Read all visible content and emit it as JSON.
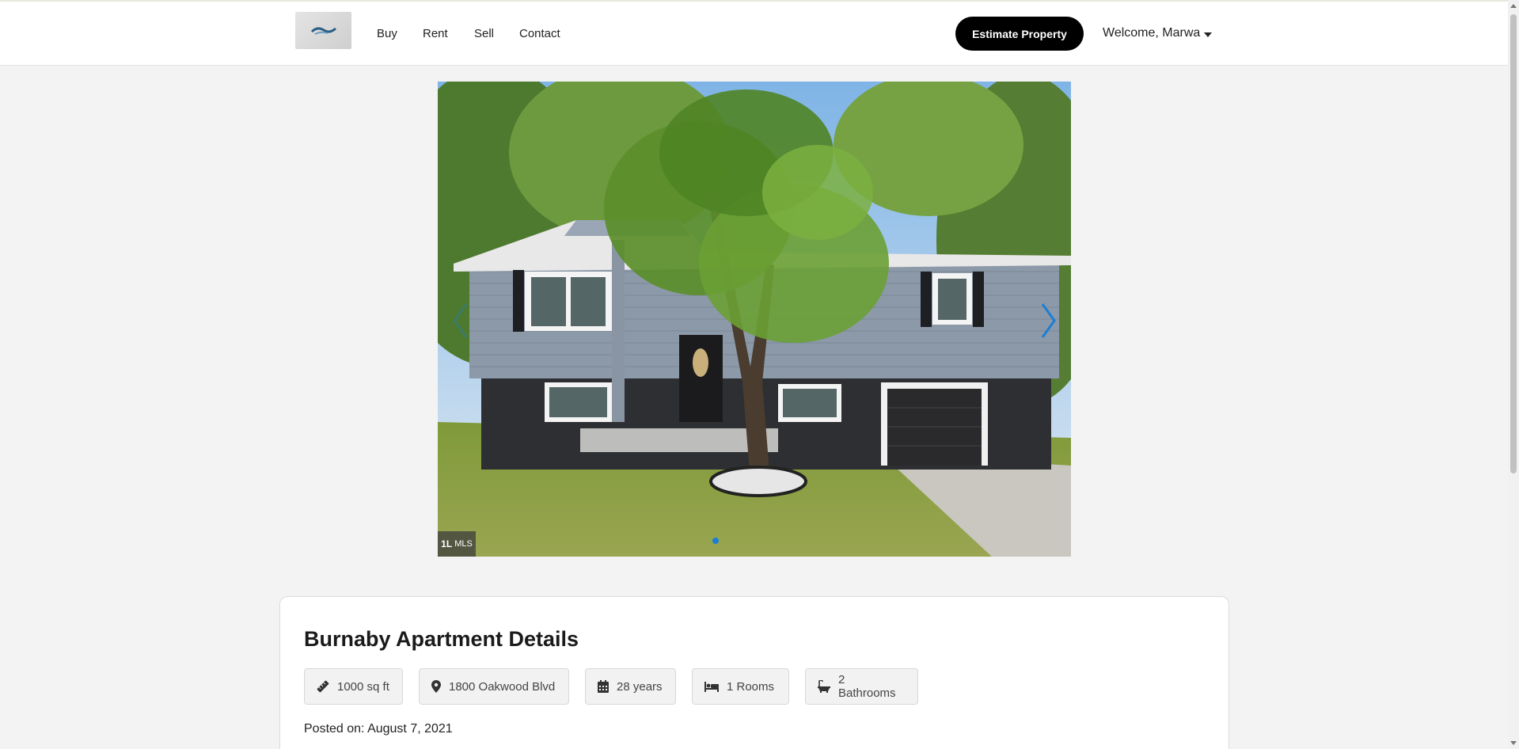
{
  "header": {
    "nav": [
      {
        "label": "Buy"
      },
      {
        "label": "Rent"
      },
      {
        "label": "Sell"
      },
      {
        "label": "Contact"
      }
    ],
    "estimate_button": "Estimate Property",
    "welcome": "Welcome, Marwa"
  },
  "carousel": {
    "watermark": "MLS",
    "total_slides": 1,
    "active_slide": 1,
    "accent_color": "#1a7fd4"
  },
  "details": {
    "title": "Burnaby Apartment Details",
    "features": [
      {
        "icon": "ruler-icon",
        "label": "1000 sq ft"
      },
      {
        "icon": "map-pin-icon",
        "label": "1800 Oakwood Blvd"
      },
      {
        "icon": "calendar-icon",
        "label": "28 years"
      },
      {
        "icon": "bed-icon",
        "label": "1 Rooms"
      },
      {
        "icon": "bath-icon",
        "label": "2 Bathrooms"
      }
    ],
    "posted": "Posted on: August 7, 2021"
  }
}
